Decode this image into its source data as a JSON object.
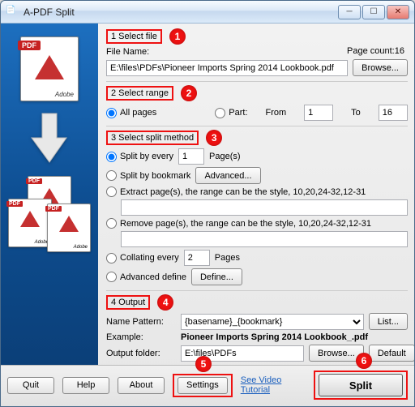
{
  "window": {
    "title": "A-PDF Split"
  },
  "sidebar": {
    "adobe_label": "Adobe"
  },
  "section1": {
    "header": "1 Select file",
    "file_name_label": "File Name:",
    "file_name_value": "E:\\files\\PDFs\\Pioneer Imports Spring 2014 Lookbook.pdf",
    "browse": "Browse...",
    "page_count_label": "Page count:",
    "page_count_value": "16"
  },
  "section2": {
    "header": "2 Select range",
    "all_pages": "All pages",
    "part": "Part:",
    "from": "From",
    "from_val": "1",
    "to": "To",
    "to_val": "16"
  },
  "section3": {
    "header": "3 Select split method",
    "split_every": "Split by every",
    "split_every_val": "1",
    "pages_suffix": "Page(s)",
    "split_bookmark": "Split by bookmark",
    "advanced": "Advanced...",
    "extract_label": "Extract page(s), the range can be the style, 10,20,24-32,12-31",
    "extract_value": "",
    "remove_label": "Remove page(s), the range can be the style, 10,20,24-32,12-31",
    "remove_value": "",
    "collating": "Collating every",
    "collating_val": "2",
    "collating_suffix": "Pages",
    "advanced_define": "Advanced define",
    "define": "Define..."
  },
  "section4": {
    "header": "4 Output",
    "name_pattern_label": "Name Pattern:",
    "name_pattern_value": "{basename}_{bookmark}",
    "list": "List...",
    "example_label": "Example:",
    "example_value": "Pioneer Imports Spring 2014 Lookbook_.pdf",
    "output_folder_label": "Output folder:",
    "output_folder_value": "E:\\files\\PDFs",
    "browse": "Browse...",
    "default": "Default"
  },
  "footer": {
    "quit": "Quit",
    "help": "Help",
    "about": "About",
    "settings": "Settings",
    "video": "See Video Tutorial",
    "split": "Split"
  },
  "callouts": {
    "c1": "1",
    "c2": "2",
    "c3": "3",
    "c4": "4",
    "c5": "5",
    "c6": "6"
  }
}
